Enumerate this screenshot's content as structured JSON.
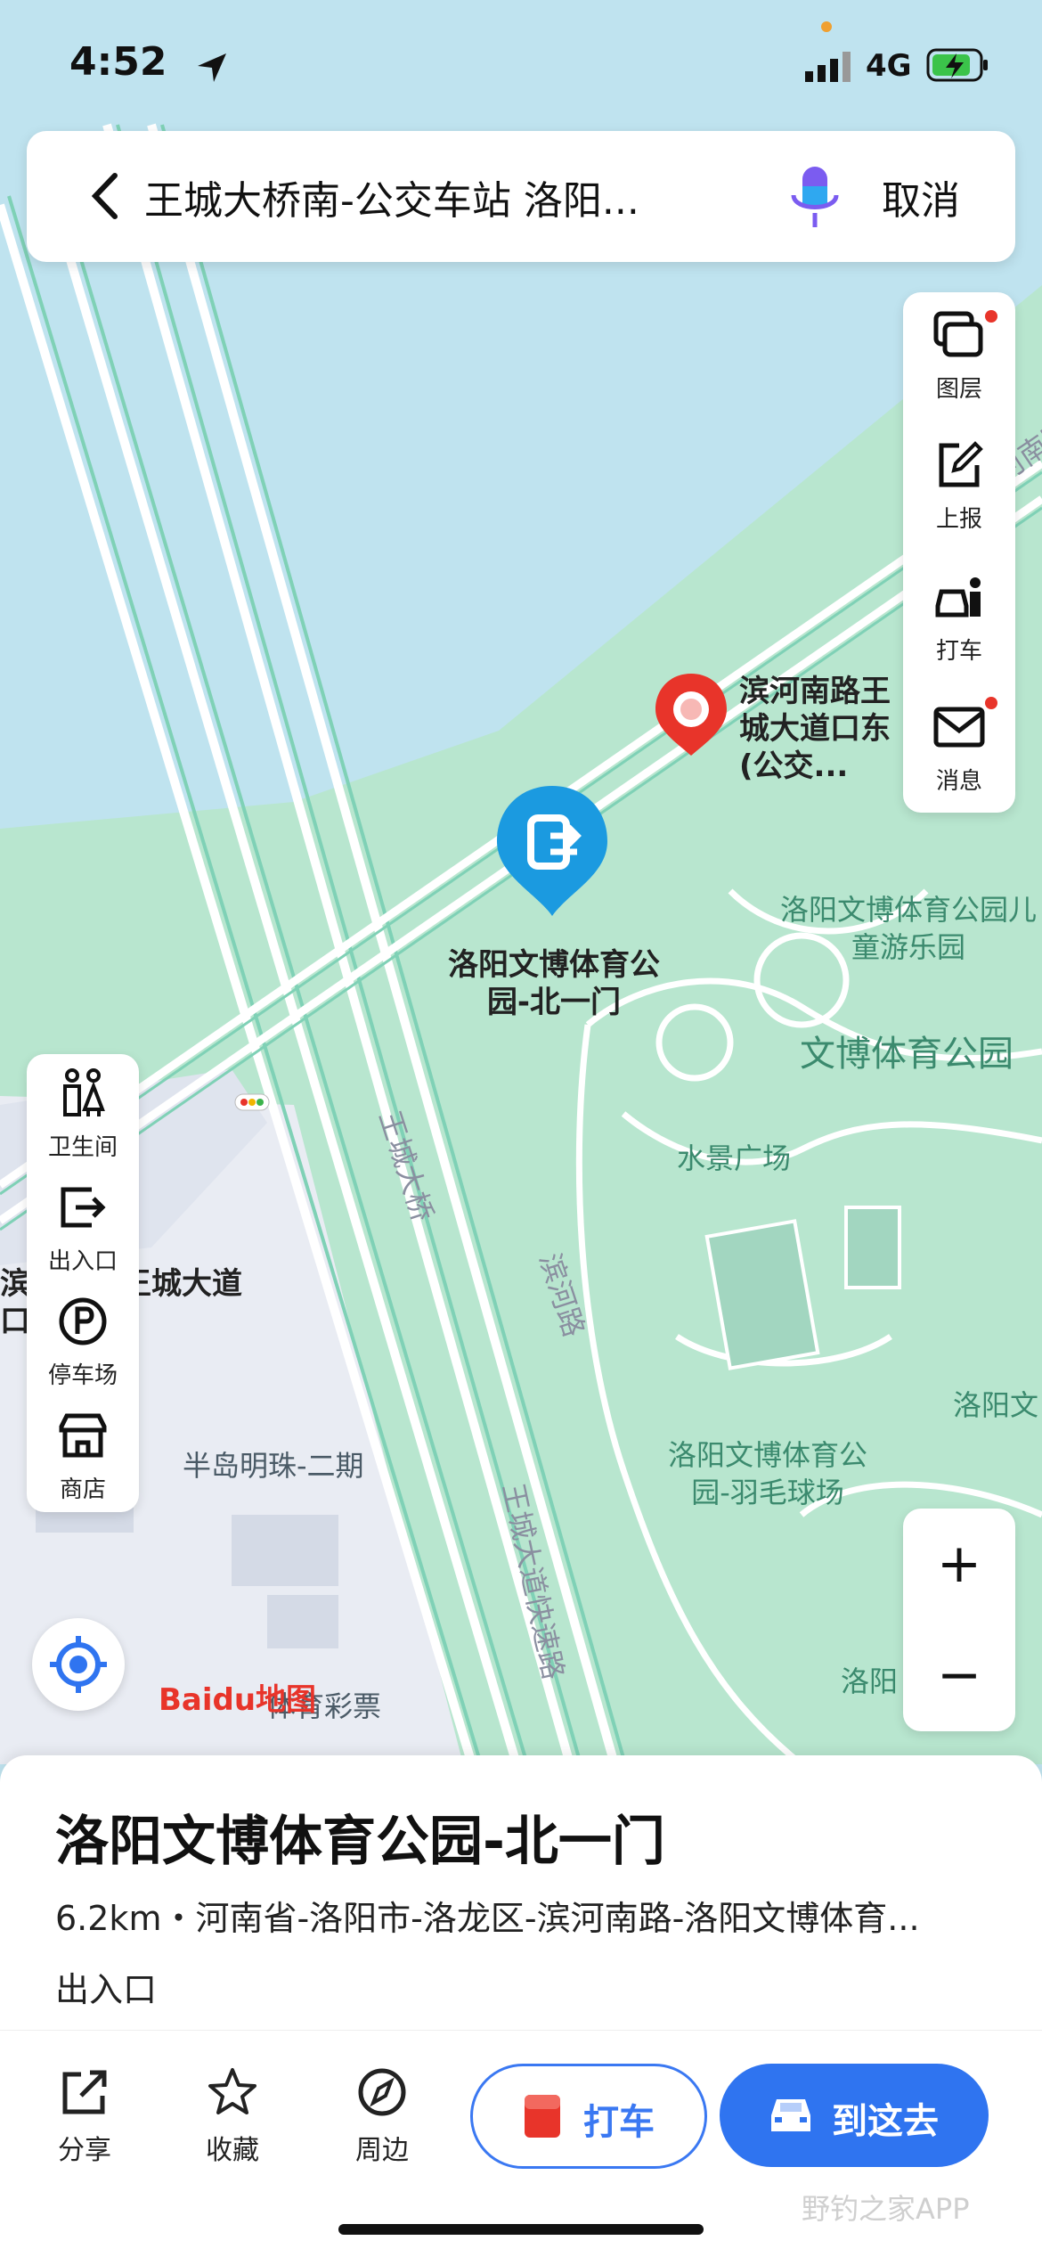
{
  "status_bar": {
    "time": "4:52",
    "network": "4G"
  },
  "search": {
    "query": "王城大桥南-公交车站 洛阳...",
    "cancel_label": "取消"
  },
  "right_tools": [
    {
      "label": "图层",
      "icon": "layers-icon"
    },
    {
      "label": "上报",
      "icon": "report-edit-icon"
    },
    {
      "label": "打车",
      "icon": "taxi-person-icon"
    },
    {
      "label": "消息",
      "icon": "mail-icon"
    }
  ],
  "left_tools": [
    {
      "label": "卫生间",
      "icon": "restroom-icon"
    },
    {
      "label": "出入口",
      "icon": "exit-icon"
    },
    {
      "label": "停车场",
      "icon": "parking-icon"
    },
    {
      "label": "商店",
      "icon": "store-icon"
    }
  ],
  "map_labels": {
    "selected_poi": "洛阳文博体育公园-北一门",
    "bus_stop_east": "滨河南路王城大道口东(公交...",
    "bus_stop_west": "滨河南路王城大道口(公交...",
    "park": "文博体育公园",
    "kids_park": "洛阳文博体育公园儿童游乐园",
    "water_square": "水景广场",
    "badminton": "洛阳文博体育公园-羽毛球场",
    "bridge": "王城大桥",
    "binhe_road": "滨河路",
    "expressway": "王城大道快速路",
    "residential": "半岛明珠-二期",
    "lottery": "体育彩票",
    "road_ne": "滨河南路",
    "east_edge": "洛阳文",
    "southeast": "洛阳"
  },
  "logo": "Baidu地图",
  "panel": {
    "title": "洛阳文博体育公园-北一门",
    "address": "6.2km・河南省-洛阳市-洛龙区-滨河南路-洛阳文博体育...",
    "category": "出入口"
  },
  "bottom_bar": {
    "share": "分享",
    "favorite": "收藏",
    "nearby": "周边",
    "taxi": "打车",
    "go_here": "到这去"
  },
  "watermark": "野钓之家APP",
  "colors": {
    "accent": "#2f74f0",
    "water": "#bfe3ef",
    "park": "#b8e6cf",
    "marker_red": "#e8342a",
    "marker_blue": "#1b9ae0"
  }
}
